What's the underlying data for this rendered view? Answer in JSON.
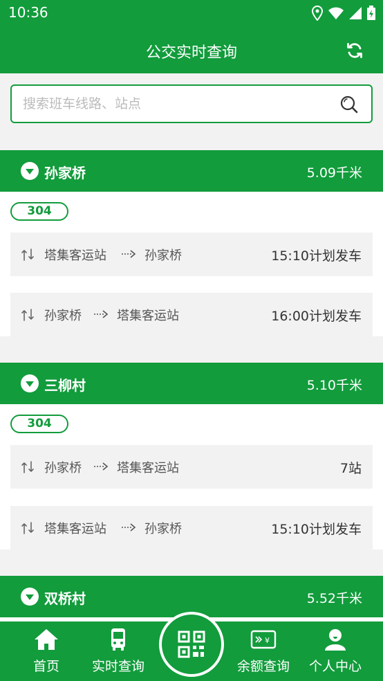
{
  "status_bar": {
    "time": "10:36"
  },
  "header": {
    "title": "公交实时查询"
  },
  "search": {
    "placeholder": "搜索班车线路、站点"
  },
  "stations": [
    {
      "name": "孙家桥",
      "distance": "5.09千米",
      "line": "304",
      "routes": [
        {
          "from": "塔集客运站",
          "to": "孙家桥",
          "status": "15:10计划发车"
        },
        {
          "from": "孙家桥",
          "to": "塔集客运站",
          "status": "16:00计划发车"
        }
      ]
    },
    {
      "name": "三柳村",
      "distance": "5.10千米",
      "line": "304",
      "routes": [
        {
          "from": "孙家桥",
          "to": "塔集客运站",
          "status": "7站"
        },
        {
          "from": "塔集客运站",
          "to": "孙家桥",
          "status": "15:10计划发车"
        }
      ]
    },
    {
      "name": "双桥村",
      "distance": "5.52千米"
    }
  ],
  "bottom_nav": {
    "home": "首页",
    "realtime": "实时查询",
    "balance": "余额查询",
    "profile": "个人中心"
  },
  "colors": {
    "primary": "#129c3c"
  }
}
